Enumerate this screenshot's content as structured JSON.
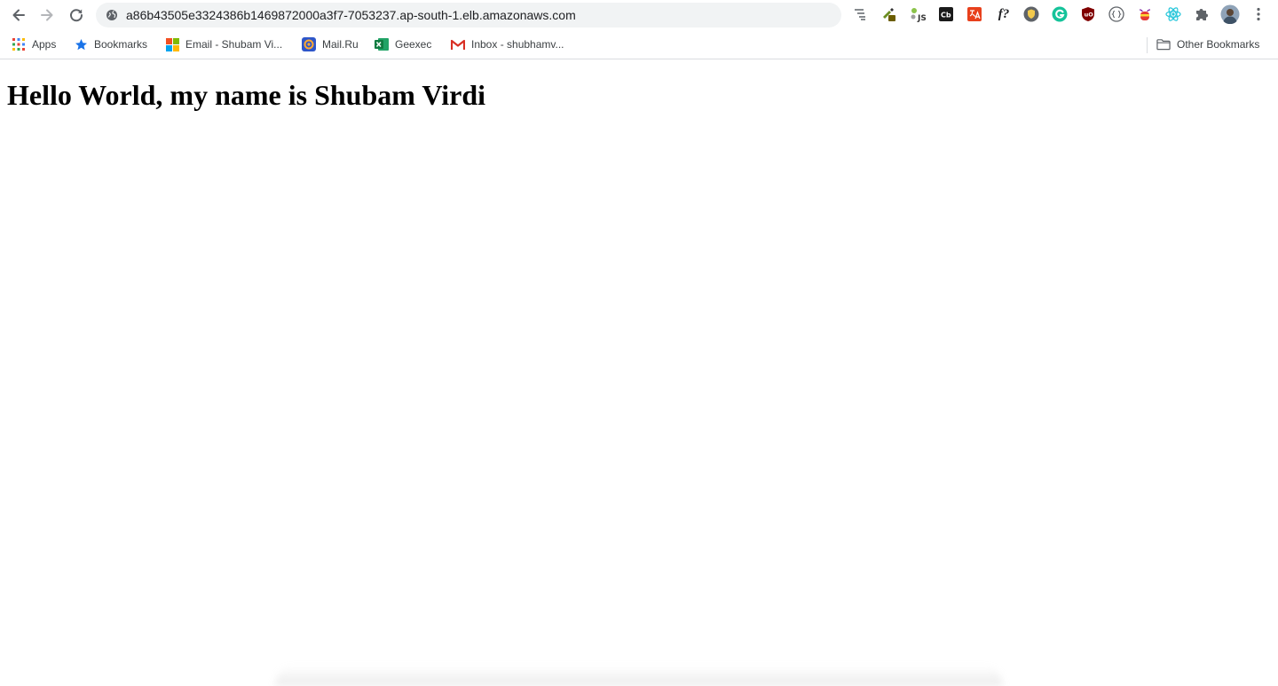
{
  "browser": {
    "url": "a86b43505e3324386b1469872000a3f7-7053237.ap-south-1.elb.amazonaws.com",
    "nav": {
      "back_icon": "arrow-left-icon",
      "forward_icon": "arrow-right-icon",
      "reload_icon": "reload-icon",
      "site_info_icon": "globe-icon"
    },
    "extensions": [
      {
        "name": "tab-list-icon"
      },
      {
        "name": "eyedropper-extension-icon"
      },
      {
        "name": "js-extension-icon",
        "text": "JS"
      },
      {
        "name": "cb-extension-icon",
        "text": "Cb"
      },
      {
        "name": "translate-extension-icon"
      },
      {
        "name": "font-extension-icon",
        "text": "f?"
      },
      {
        "name": "shield-extension-icon"
      },
      {
        "name": "grammarly-extension-icon",
        "text": "G"
      },
      {
        "name": "ublock-extension-icon",
        "text": "uO"
      },
      {
        "name": "devtools-extension-icon",
        "text": "{·}"
      },
      {
        "name": "bee-extension-icon"
      },
      {
        "name": "react-extension-icon"
      },
      {
        "name": "puzzle-icon"
      },
      {
        "name": "profile-avatar"
      },
      {
        "name": "kebab-menu-icon"
      }
    ]
  },
  "bookmarks": {
    "items": [
      {
        "label": "Apps",
        "icon": "apps-grid-icon"
      },
      {
        "label": "Bookmarks",
        "icon": "star-icon"
      },
      {
        "label": "Email - Shubam Vi...",
        "icon": "microsoft-icon"
      },
      {
        "label": "Mail.Ru",
        "icon": "mailru-icon"
      },
      {
        "label": "Geexec",
        "icon": "excel-icon"
      },
      {
        "label": "Inbox - shubhamv...",
        "icon": "gmail-icon"
      }
    ],
    "other": {
      "label": "Other Bookmarks",
      "icon": "folder-icon"
    }
  },
  "page": {
    "heading": "Hello World, my name is Shubam Virdi"
  },
  "colors": {
    "toolbar_bg": "#ffffff",
    "omnibox_bg": "#f1f3f4",
    "icon_grey": "#5f6368",
    "text_dark": "#202124"
  }
}
